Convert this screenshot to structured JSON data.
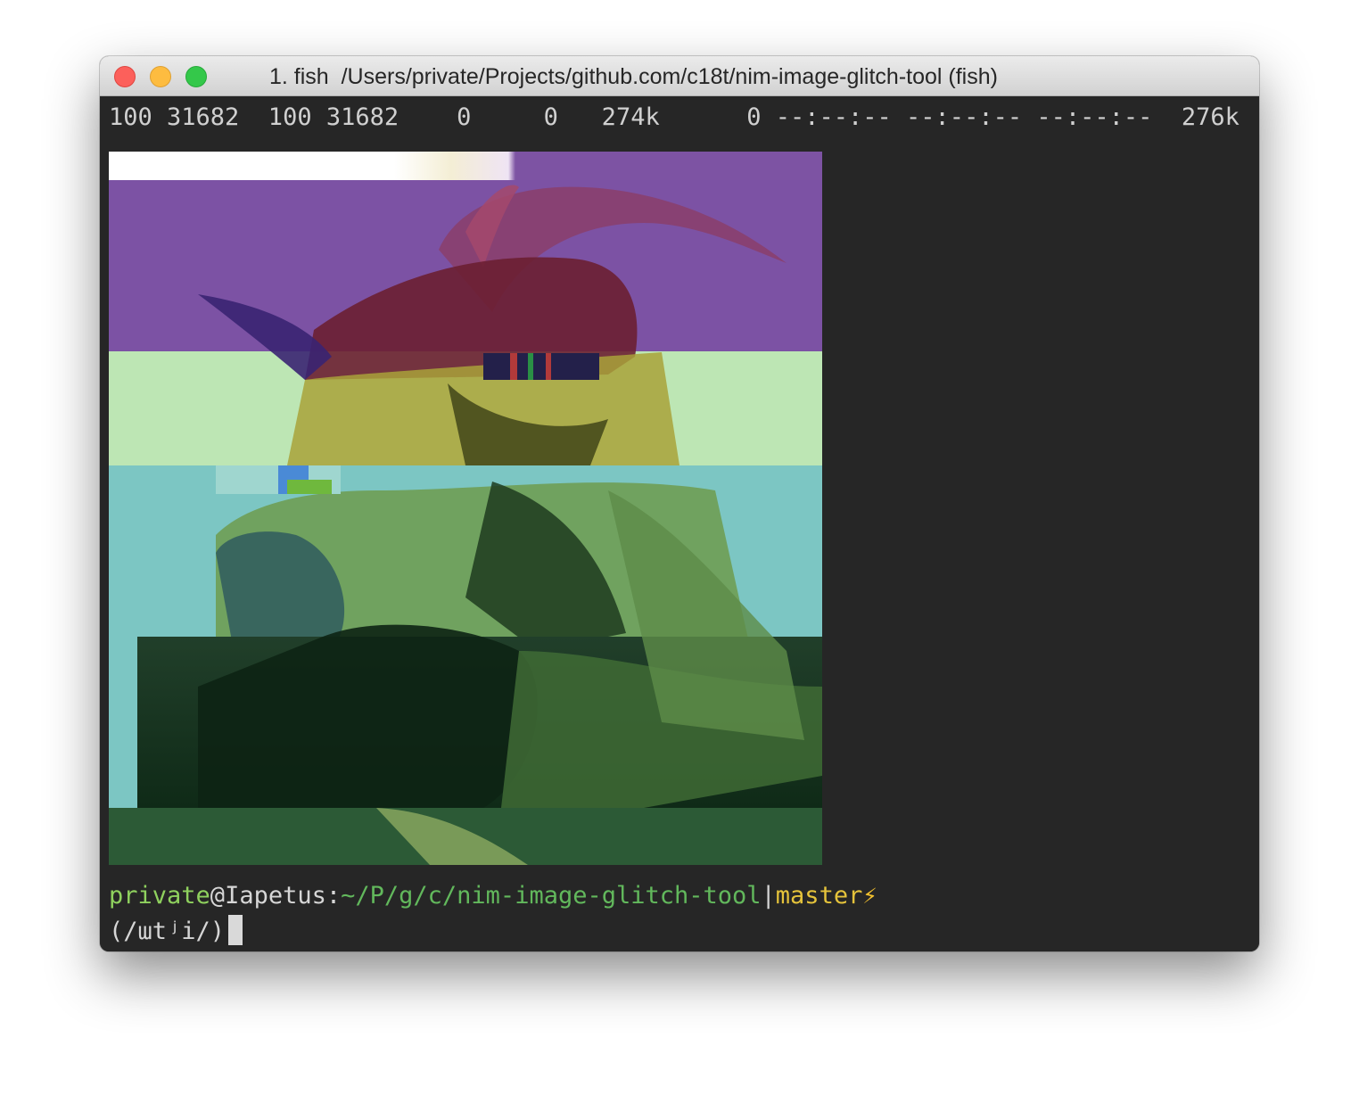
{
  "window": {
    "title": "1. fish  /Users/private/Projects/github.com/c18t/nim-image-glitch-tool (fish)"
  },
  "terminal": {
    "progress_line": "100 31682  100 31682    0     0   274k      0 --:--:-- --:--:-- --:--:--  276k",
    "prompt": {
      "user": "private",
      "at": "@",
      "host": "Iapetus",
      "colon": ":",
      "path": "~/P/g/c/nim-image-glitch-tool",
      "separator": "|",
      "branch": "master",
      "bolt": "⚡"
    },
    "command_line": "(/ɯtʲi/)"
  },
  "colors": {
    "terminal_bg": "#262626",
    "prompt_user": "#8fd15e",
    "prompt_path": "#62b85c",
    "prompt_branch": "#e5c33b",
    "close": "#fc605b",
    "minimize": "#fdbc40",
    "maximize": "#34c84a"
  },
  "image": {
    "subject": "glitched-goat-image"
  }
}
